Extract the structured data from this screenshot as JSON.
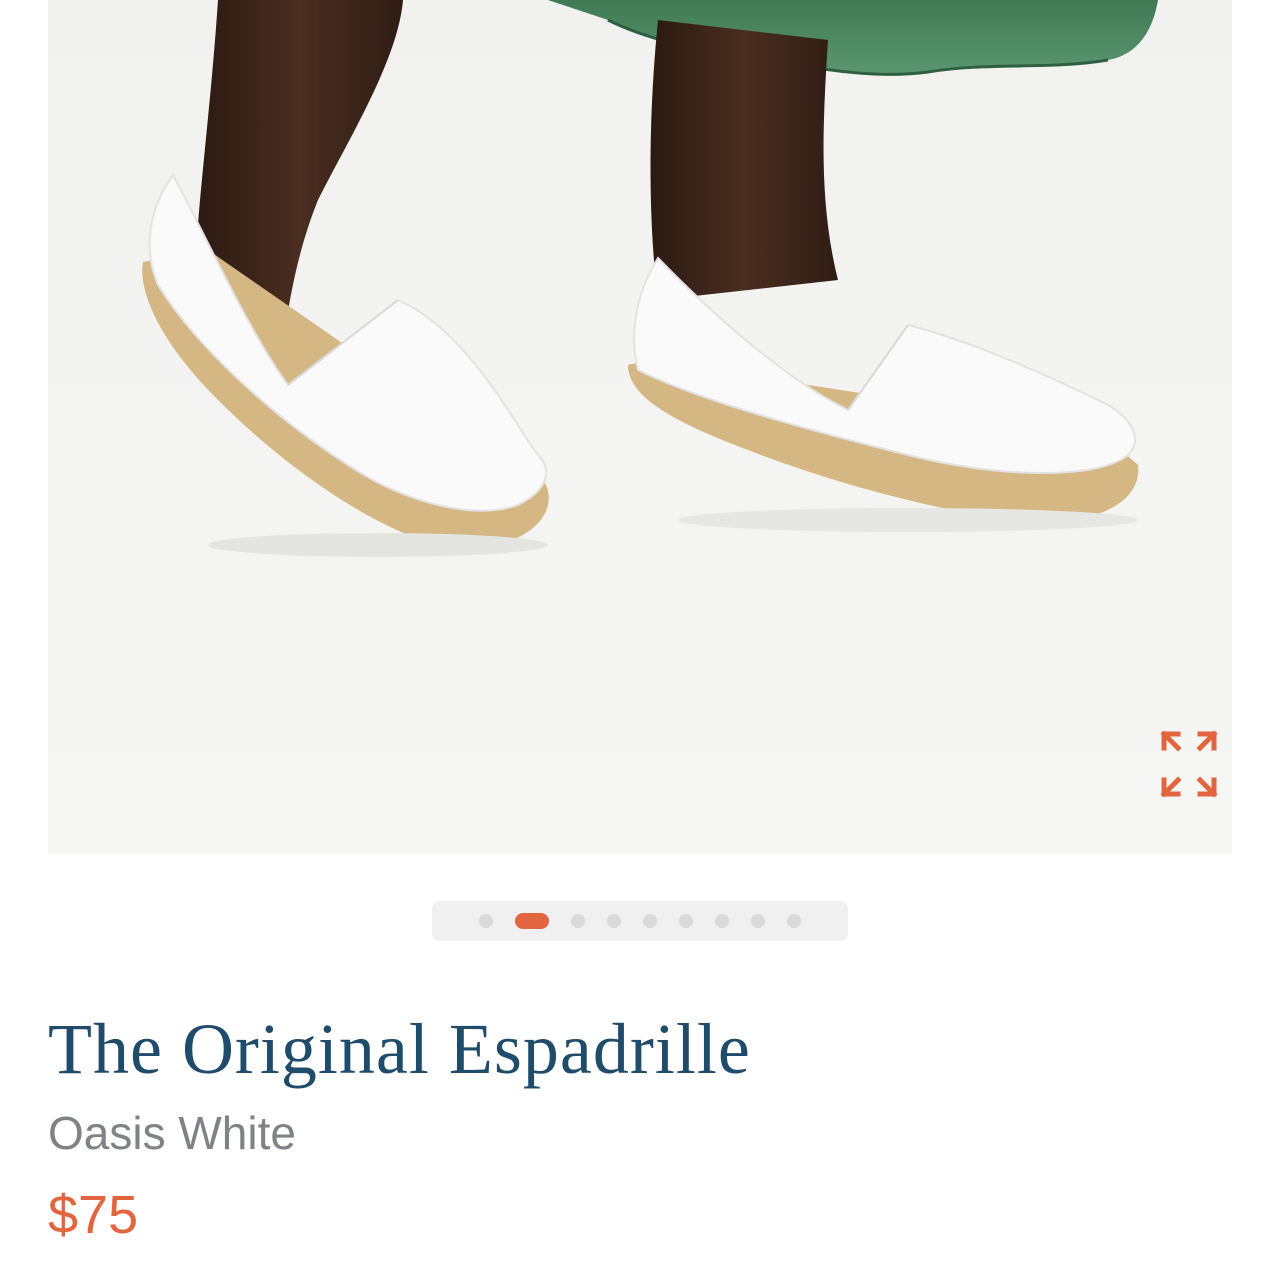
{
  "colors": {
    "accent": "#e2653f",
    "title": "#1f4c6b",
    "variant_text": "#808285",
    "dot_inactive": "#dadada"
  },
  "gallery": {
    "image": "product-photo-white-espadrilles-on-feet",
    "expand_icon": "expand-arrows-icon",
    "slide_count": 9,
    "active_slide_index": 1
  },
  "product": {
    "title": "The Original Espadrille",
    "variant": "Oasis White",
    "price": "$75"
  }
}
